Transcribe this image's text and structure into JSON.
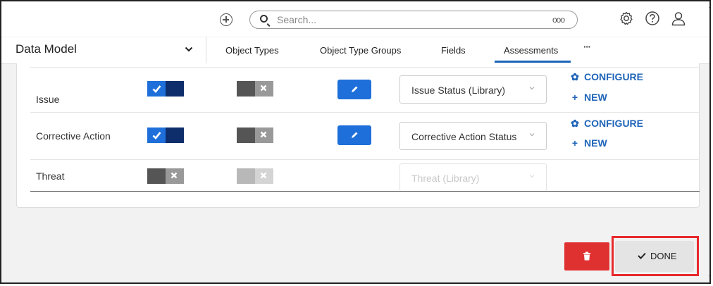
{
  "search": {
    "placeholder": "Search...",
    "more": "ooo"
  },
  "header": {
    "title": "Data Model",
    "tabs": [
      {
        "label": "Object Types"
      },
      {
        "label": "Object Type Groups"
      },
      {
        "label": "Fields"
      },
      {
        "label": "Assessments",
        "active": true
      },
      {
        "label": "···"
      }
    ]
  },
  "rows": [
    {
      "name": "Issue",
      "toggle1": "on",
      "toggle2": "off",
      "select_value": "Issue Status (Library)",
      "configure_label": "CONFIGURE",
      "new_label": "NEW"
    },
    {
      "name": "Corrective Action",
      "toggle1": "on",
      "toggle2": "off",
      "select_value": "Corrective Action Status",
      "configure_label": "CONFIGURE",
      "new_label": "NEW"
    },
    {
      "name": "Threat",
      "toggle1": "off",
      "toggle2": "disabled",
      "select_value": "Threat (Library)"
    }
  ],
  "footer": {
    "done_label": "DONE"
  },
  "colors": {
    "primary": "#1e6fd9",
    "danger": "#e03131",
    "highlight": "#e8292d",
    "link": "#1e64b8"
  },
  "icons": [
    "add-icon",
    "search-icon",
    "settings-icon",
    "help-icon",
    "user-icon",
    "chevron-down-icon",
    "pencil-icon",
    "gear-icon",
    "plus-icon",
    "trash-icon",
    "check-icon"
  ]
}
